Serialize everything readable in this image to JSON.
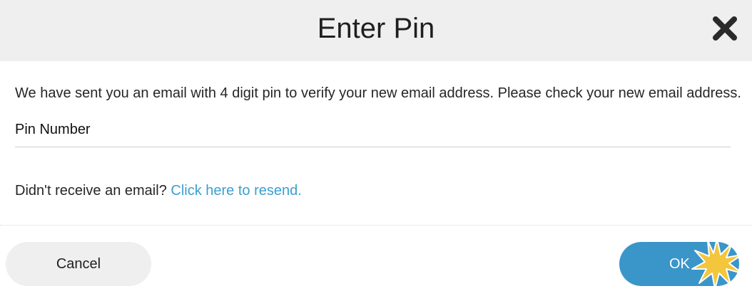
{
  "dialog": {
    "title": "Enter Pin",
    "close_icon": "close-icon",
    "message": "We have sent you an email with 4 digit pin to verify your new email address. Please check your new email address.",
    "pin_field": {
      "label": "Pin Number",
      "value": ""
    },
    "resend": {
      "prompt": "Didn't receive an email? ",
      "link_label": "Click here to resend."
    },
    "buttons": {
      "cancel_label": "Cancel",
      "ok_label": "OK"
    }
  },
  "colors": {
    "header_bg": "#efefef",
    "link": "#3a9fd0",
    "primary": "#3a95c9",
    "secondary_bg": "#efefef",
    "click_burst": "#f3c63b"
  }
}
